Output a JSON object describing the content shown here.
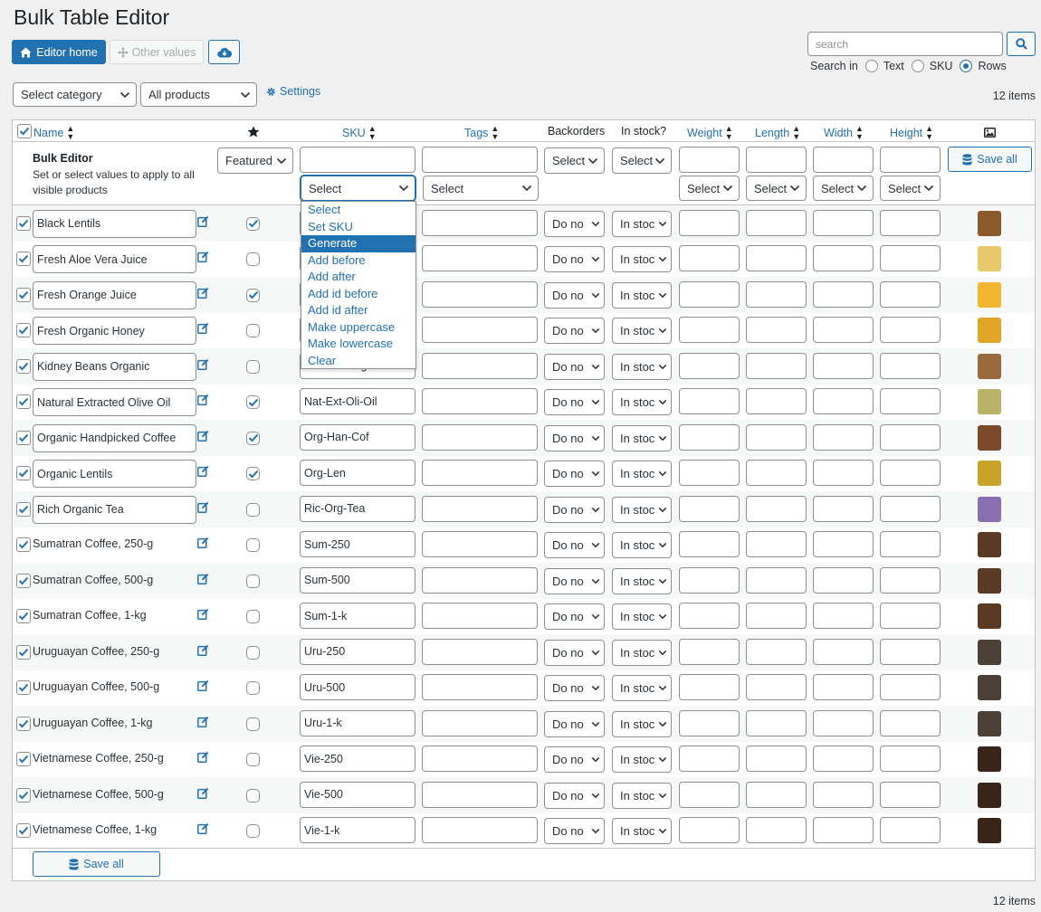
{
  "page": {
    "title": "Bulk Table Editor",
    "item_count_top": "12 items",
    "item_count_bottom": "12 items"
  },
  "toolbar": {
    "editor_home": "Editor home",
    "other_values": "Other values",
    "search_placeholder": "search",
    "search_in_label": "Search in",
    "search_options": [
      "Text",
      "SKU",
      "Rows"
    ],
    "search_selected": "Rows"
  },
  "filters": {
    "category": "Select category",
    "products": "All products",
    "settings": "Settings"
  },
  "columns": {
    "name": "Name",
    "sku": "SKU",
    "tags": "Tags",
    "backorders": "Backorders",
    "in_stock": "In stock?",
    "weight": "Weight",
    "length": "Length",
    "width": "Width",
    "height": "Height"
  },
  "bulk": {
    "title": "Bulk Editor",
    "description": "Set or select values to apply to all visible products",
    "featured": "Featured",
    "select": "Select",
    "save_all": "Save all"
  },
  "sku_dropdown": {
    "options": [
      "Select",
      "Set SKU",
      "Generate",
      "Add before",
      "Add after",
      "Add id before",
      "Add id after",
      "Make uppercase",
      "Make lowercase",
      "Clear"
    ],
    "highlighted": "Generate"
  },
  "row_defaults": {
    "backorders": "Do no",
    "stock": "In stoc"
  },
  "rows": [
    {
      "name": "Black Lentils",
      "sku": "",
      "featured": true,
      "boxed": true,
      "thumb": "#8b5a2b"
    },
    {
      "name": "Fresh Aloe Vera Juice",
      "sku": "",
      "featured": false,
      "boxed": true,
      "thumb": "#e8c66a"
    },
    {
      "name": "Fresh Orange Juice",
      "sku": "",
      "featured": true,
      "boxed": true,
      "thumb": "#f2b632"
    },
    {
      "name": "Fresh Organic Honey",
      "sku": "",
      "featured": false,
      "boxed": true,
      "thumb": "#e0a526"
    },
    {
      "name": "Kidney Beans Organic",
      "sku": "Kid-Bea-Org",
      "featured": false,
      "boxed": true,
      "thumb": "#9a6a3c"
    },
    {
      "name": "Natural Extracted Olive Oil",
      "sku": "Nat-Ext-Oli-Oil",
      "featured": true,
      "boxed": true,
      "thumb": "#b9b36a"
    },
    {
      "name": "Organic Handpicked Coffee",
      "sku": "Org-Han-Cof",
      "featured": true,
      "boxed": true,
      "thumb": "#7a4a2a"
    },
    {
      "name": "Organic Lentils",
      "sku": "Org-Len",
      "featured": true,
      "boxed": true,
      "thumb": "#c9a22a"
    },
    {
      "name": "Rich Organic Tea",
      "sku": "Ric-Org-Tea",
      "featured": false,
      "boxed": true,
      "thumb": "#8a6fb0"
    },
    {
      "name": "Sumatran Coffee, 250-g",
      "sku": "Sum-250",
      "featured": false,
      "boxed": false,
      "thumb": "#5a3a22"
    },
    {
      "name": "Sumatran Coffee, 500-g",
      "sku": "Sum-500",
      "featured": false,
      "boxed": false,
      "thumb": "#5a3a22"
    },
    {
      "name": "Sumatran Coffee, 1-kg",
      "sku": "Sum-1-k",
      "featured": false,
      "boxed": false,
      "thumb": "#5a3a22"
    },
    {
      "name": "Uruguayan Coffee, 250-g",
      "sku": "Uru-250",
      "featured": false,
      "boxed": false,
      "thumb": "#4a4036"
    },
    {
      "name": "Uruguayan Coffee, 500-g",
      "sku": "Uru-500",
      "featured": false,
      "boxed": false,
      "thumb": "#4a4036"
    },
    {
      "name": "Uruguayan Coffee, 1-kg",
      "sku": "Uru-1-k",
      "featured": false,
      "boxed": false,
      "thumb": "#4a4036"
    },
    {
      "name": "Vietnamese Coffee, 250-g",
      "sku": "Vie-250",
      "featured": false,
      "boxed": false,
      "thumb": "#3a2418"
    },
    {
      "name": "Vietnamese Coffee, 500-g",
      "sku": "Vie-500",
      "featured": false,
      "boxed": false,
      "thumb": "#3a2418"
    },
    {
      "name": "Vietnamese Coffee, 1-kg",
      "sku": "Vie-1-k",
      "featured": false,
      "boxed": false,
      "thumb": "#3a2418"
    }
  ],
  "colors": {
    "accent": "#2271b1",
    "text": "#1d2327",
    "border": "#8c8f94",
    "row_alt": "#f6f7f7"
  }
}
